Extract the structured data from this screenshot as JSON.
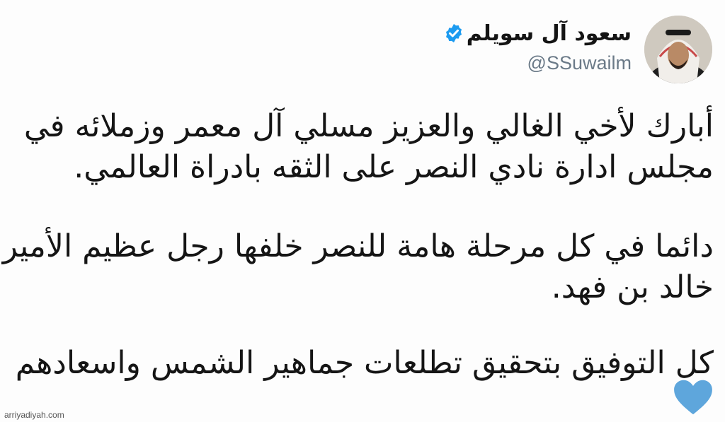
{
  "author": {
    "display_name": "سعود آل سويلم",
    "handle": "@SSuwailm",
    "verified": true,
    "avatar_icon": "profile-photo"
  },
  "tweet": {
    "paragraphs": [
      {
        "lines": [
          "أبارك لأخي الغالي والعزيز مسلي آل معمر وزملائه في",
          "مجلس ادارة نادي النصر على الثقه بادراة العالمي."
        ]
      },
      {
        "lines": [
          "دائما في كل مرحلة هامة للنصر خلفها رجل عظيم الأمير",
          "خالد بن فهد."
        ]
      },
      {
        "lines": [
          "كل التوفيق بتحقيق تطلعات جماهير الشمس واسعادهم"
        ]
      }
    ],
    "emoji": "blue-heart"
  },
  "watermark": "arriyadiyah.com",
  "colors": {
    "verified_badge": "#1d9bf0",
    "handle": "#6b7a88",
    "heart": "#5ea6dc"
  }
}
